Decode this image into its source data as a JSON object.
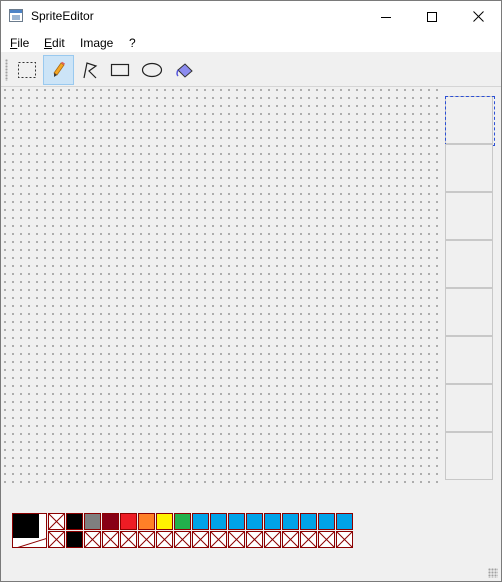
{
  "window": {
    "title": "SpriteEditor"
  },
  "menu": [
    {
      "accel": "F",
      "rest": "ile"
    },
    {
      "accel": "E",
      "rest": "dit"
    },
    {
      "accel": "",
      "rest": "Image"
    },
    {
      "accel": "",
      "rest": "?"
    }
  ],
  "toolbar": {
    "tools": [
      {
        "icon": "selection-icon",
        "active": false
      },
      {
        "icon": "pencil-icon",
        "active": true
      },
      {
        "icon": "polyline-icon",
        "active": false
      },
      {
        "icon": "rectangle-icon",
        "active": false
      },
      {
        "icon": "ellipse-icon",
        "active": false
      },
      {
        "icon": "fill-bucket-icon",
        "active": false
      }
    ]
  },
  "frames": {
    "count": 8,
    "selected_index": 0
  },
  "palette": {
    "foreground": "#000000",
    "background": "transparent",
    "top_row": [
      "transparent",
      "#000000",
      "#7f7f7f",
      "#880015",
      "#ed1c24",
      "#ff7f27",
      "#fff200",
      "#22b14c",
      "#00a2e8",
      "#00a2e8",
      "#00a2e8",
      "#00a2e8",
      "#00a2e8",
      "#00a2e8",
      "#00a2e8",
      "#00a2e8",
      "#00a2e8"
    ],
    "bottom_row": [
      "transparent",
      "#000000",
      "transparent",
      "transparent",
      "transparent",
      "transparent",
      "transparent",
      "transparent",
      "transparent",
      "transparent",
      "transparent",
      "transparent",
      "transparent",
      "transparent",
      "transparent",
      "transparent",
      "transparent"
    ]
  }
}
